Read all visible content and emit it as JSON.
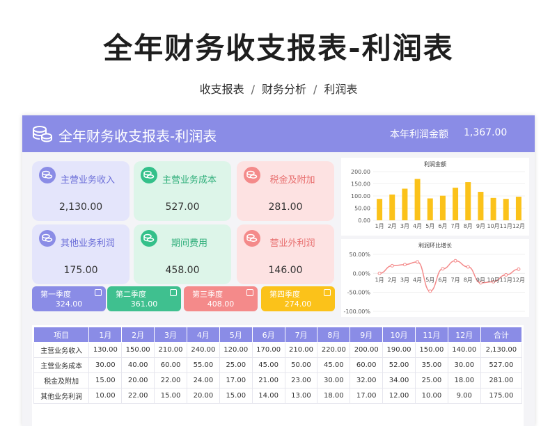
{
  "page_title": "全年财务收支报表-利润表",
  "breadcrumb": [
    "收支报表",
    "财务分析",
    "利润表"
  ],
  "breadcrumb_sep": "/",
  "header": {
    "title": "全年财务收支报表-利润表",
    "profit_label": "本年利润金额",
    "profit_value": "1,367.00"
  },
  "cards": [
    {
      "label": "主营业务收入",
      "value": "2,130.00",
      "bg": "#e4e5fb",
      "icon": "#8a8ce6",
      "color": "#6b6ed8"
    },
    {
      "label": "主营业务成本",
      "value": "527.00",
      "bg": "#ddf5e9",
      "icon": "#34c08a",
      "color": "#2fae7a"
    },
    {
      "label": "税金及附加",
      "value": "281.00",
      "bg": "#fde2e2",
      "icon": "#f48a8a",
      "color": "#e86f6f"
    },
    {
      "label": "其他业务利润",
      "value": "175.00",
      "bg": "#e4e5fb",
      "icon": "#8a8ce6",
      "color": "#6b6ed8"
    },
    {
      "label": "期间费用",
      "value": "458.00",
      "bg": "#ddf5e9",
      "icon": "#34c08a",
      "color": "#2fae7a"
    },
    {
      "label": "营业外利润",
      "value": "146.00",
      "bg": "#fde2e2",
      "icon": "#f48a8a",
      "color": "#e86f6f"
    }
  ],
  "quarters": [
    {
      "label": "第一季度",
      "value": "324.00",
      "bg": "#8a8ce6"
    },
    {
      "label": "第二季度",
      "value": "361.00",
      "bg": "#3fc08f"
    },
    {
      "label": "第三季度",
      "value": "408.00",
      "bg": "#f48a8a"
    },
    {
      "label": "第四季度",
      "value": "274.00",
      "bg": "#fbc21a"
    }
  ],
  "chart_data": [
    {
      "type": "bar",
      "title": "利润金额",
      "categories": [
        "1月",
        "2月",
        "3月",
        "4月",
        "5月",
        "6月",
        "7月",
        "8月",
        "9月",
        "10月",
        "11月",
        "12月"
      ],
      "values": [
        88,
        106,
        130,
        170,
        90,
        101,
        134,
        157,
        117,
        92,
        88,
        97
      ],
      "ylim": [
        0,
        200
      ],
      "yticks": [
        "200.00",
        "150.00",
        "100.00",
        "50.00",
        "0.00"
      ],
      "color": "#fbc21a"
    },
    {
      "type": "line",
      "title": "利润环比增长",
      "categories": [
        "1月",
        "2月",
        "3月",
        "4月",
        "5月",
        "6月",
        "7月",
        "8月",
        "9月",
        "10月",
        "11月",
        "12月"
      ],
      "values": [
        0,
        20,
        23,
        30,
        -47,
        12,
        33,
        17,
        -25,
        -22,
        -4,
        11
      ],
      "ylim": [
        -100,
        50
      ],
      "yticks": [
        "50.00%",
        "0.00%",
        "-50.00%",
        "-100.00%"
      ],
      "color": "#f48a8a"
    }
  ],
  "table": {
    "headers": [
      "项目",
      "1月",
      "2月",
      "3月",
      "4月",
      "5月",
      "6月",
      "7月",
      "8月",
      "9月",
      "10月",
      "11月",
      "12月",
      "合计"
    ],
    "rows": [
      [
        "主营业务收入",
        "130.00",
        "150.00",
        "210.00",
        "240.00",
        "120.00",
        "170.00",
        "210.00",
        "220.00",
        "200.00",
        "190.00",
        "150.00",
        "140.00",
        "2,130.00"
      ],
      [
        "主营业务成本",
        "30.00",
        "40.00",
        "60.00",
        "55.00",
        "25.00",
        "45.00",
        "50.00",
        "45.00",
        "60.00",
        "52.00",
        "35.00",
        "30.00",
        "527.00"
      ],
      [
        "税金及附加",
        "15.00",
        "20.00",
        "22.00",
        "24.00",
        "17.00",
        "21.00",
        "23.00",
        "30.00",
        "32.00",
        "34.00",
        "25.00",
        "18.00",
        "281.00"
      ],
      [
        "其他业务利润",
        "10.00",
        "22.00",
        "15.00",
        "20.00",
        "15.00",
        "14.00",
        "13.00",
        "18.00",
        "17.00",
        "12.00",
        "10.00",
        "9.00",
        "175.00"
      ]
    ]
  }
}
